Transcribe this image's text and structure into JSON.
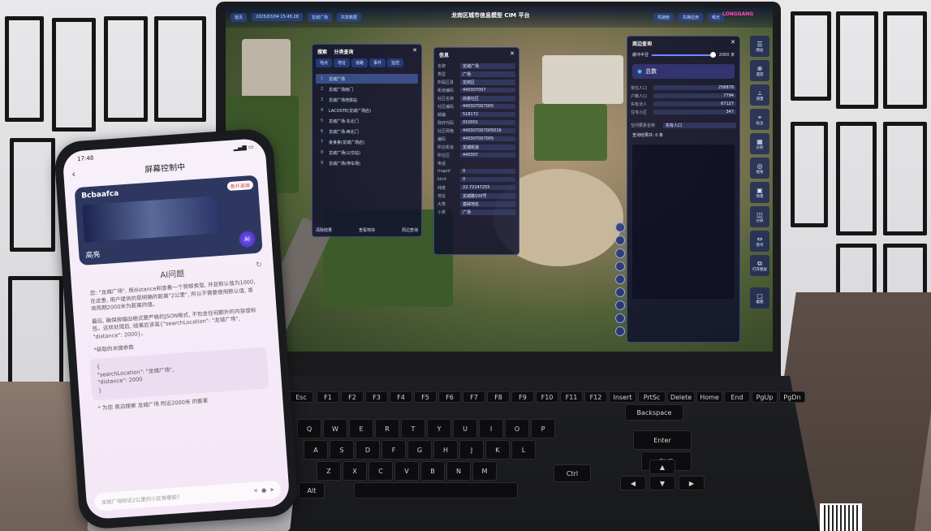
{
  "laptop_screen": {
    "topbar": {
      "home": "首页",
      "datetime": "2025/03/04 15:45:28",
      "location_search": "龙城广场",
      "data_label": "共享数据",
      "system_title": "龙岗区城市信息模型 CIM 平台",
      "platform_tag": "CIM",
      "cockpit": "驾驶舱",
      "apps": "先锋应用",
      "weather": "晴天",
      "login": "LONGGANG"
    },
    "search_panel": {
      "tab_search": "搜索",
      "tab_category": "分类查询",
      "filters": [
        "地点",
        "地址",
        "道路",
        "事件",
        "监控"
      ],
      "results": [
        "龙城广场",
        "龙城广场南门",
        "龙城广场地铁站",
        "LACOSTE(龙城广场店)",
        "龙城广场-东北门",
        "龙城广场-西北门",
        "良食荟(龙城广场店)",
        "龙城广场(公交站)",
        "龙城广场(停车场)"
      ],
      "footer": [
        "清除结果",
        "查看地块",
        "周边查询"
      ]
    },
    "info_panel": {
      "title": "信息",
      "fields": [
        {
          "k": "名称",
          "v": "龙城广场"
        },
        {
          "k": "类型",
          "v": "广场"
        },
        {
          "k": "所属区县",
          "v": "龙岗区"
        },
        {
          "k": "街道编码",
          "v": "440307007"
        },
        {
          "k": "社区名称",
          "v": "尚景社区"
        },
        {
          "k": "社区编码",
          "v": "440307007005"
        },
        {
          "k": "邮编",
          "v": "518172"
        },
        {
          "k": "政府代码",
          "v": "010001"
        },
        {
          "k": "社区网格",
          "v": "440307007005016"
        },
        {
          "k": "编码",
          "v": "440307007005"
        },
        {
          "k": "所在街道",
          "v": "龙城街道"
        },
        {
          "k": "所在区",
          "v": "440307"
        },
        {
          "k": "电话",
          "v": ""
        },
        {
          "k": "mapid",
          "v": "0"
        },
        {
          "k": "kind",
          "v": "0"
        },
        {
          "k": "纬度",
          "v": "22.72147255"
        },
        {
          "k": "地址",
          "v": "龙城路100号"
        },
        {
          "k": "大类",
          "v": "基础地名"
        },
        {
          "k": "小类",
          "v": "广场"
        }
      ]
    },
    "around_panel": {
      "title": "周边查询",
      "radius_label": "缓冲半径",
      "radius_value": "2000 米",
      "total_label": "总数",
      "stats": [
        {
          "k": "常住人口",
          "v": "258878"
        },
        {
          "k": "户籍人口",
          "v": "7794"
        },
        {
          "k": "实有法人",
          "v": "67127"
        },
        {
          "k": "住宅小区",
          "v": "347"
        }
      ],
      "space_label": "空间要素名称",
      "space_value": "实有人口",
      "result_label": "查询结果共: 0 条"
    },
    "side_tools": [
      "图层",
      "漫游",
      "测量",
      "标注",
      "分析",
      "视角",
      "场景",
      "分屏",
      "卷帘",
      "打开图层",
      "截图"
    ]
  },
  "phone": {
    "time": "17:48",
    "header_title": "屏幕控制中",
    "device_name": "Bcbaafca",
    "disconnect": "断开连接",
    "highlight": "高亮",
    "ai_badge": "AI",
    "ai_title": "AI问题",
    "ai_paragraph_1": "您: \"龙城广场\", 用distance和查看一个就够类型, 并且默认值为1000, 在这里, 用户提供的是明确的距离\"2公里\", 所以不需要使用默认值, 查询周期2000米为距离的值。",
    "ai_paragraph_2": "最后, 确保按输出格式要严格的JSON格式, 不包含任何额外的内容或标签。这样处理后, 结果应该是{\"searchLocation\": \"龙城广场\", \"distance\": 2000}。",
    "ai_result_label": "*获取的关键参数",
    "code_line_1": "{",
    "code_line_2": "\"searchLocation\": \"龙城广场\",",
    "code_line_3": "\"distance\": 2000",
    "code_line_4": "}",
    "ai_footer": "* 为您 周边搜索 龙城广场 附近2000米 的要素",
    "input_placeholder": "龙城广场附近2公里的小区有哪些?"
  },
  "keyboard_labels": [
    "Esc",
    "F1",
    "F2",
    "F3",
    "F4",
    "F5",
    "F6",
    "F7",
    "F8",
    "F9",
    "F10",
    "F11",
    "F12",
    "Insert",
    "PrtSc",
    "Delete",
    "Home",
    "End",
    "PgUp",
    "PgDn",
    "Backspace",
    "Q",
    "W",
    "E",
    "R",
    "T",
    "Y",
    "U",
    "I",
    "O",
    "P",
    "A",
    "S",
    "D",
    "F",
    "G",
    "H",
    "J",
    "K",
    "L",
    "Enter",
    "Z",
    "X",
    "C",
    "V",
    "B",
    "N",
    "M",
    "Shift",
    "Ctrl",
    "Alt"
  ],
  "colors": {
    "panel_bg": "#10122c",
    "accent_blue": "#3b6bd8",
    "login_pink": "#ff4db8",
    "phone_bg": "#f4e6f6"
  }
}
